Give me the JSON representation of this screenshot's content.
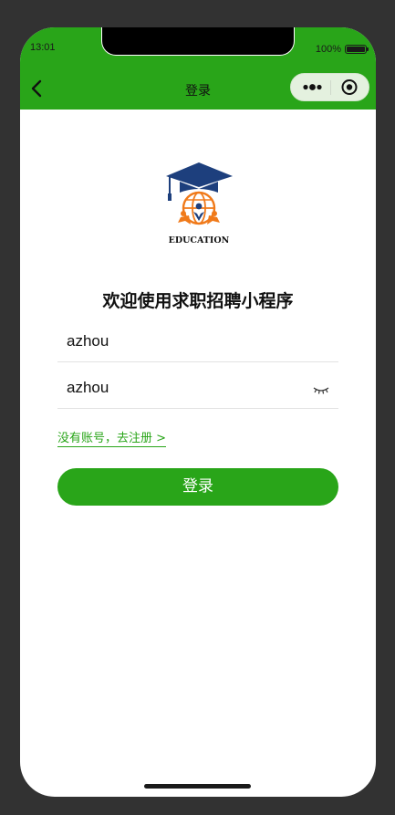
{
  "status_bar": {
    "time": "13:01",
    "battery": "100%"
  },
  "nav": {
    "title": "登录",
    "back_icon": "chevron-left-icon",
    "more_icon": "more-dots-icon",
    "close_icon": "target-close-icon"
  },
  "logo": {
    "icon": "graduation-cap-globe-icon",
    "text": "EDUCATION"
  },
  "main": {
    "title": "欢迎使用求职招聘小程序",
    "username": {
      "value": "azhou"
    },
    "password": {
      "value": "azhou",
      "toggle_icon": "eye-closed-icon"
    },
    "register_link": "没有账号，去注册 >",
    "login_button": "登录"
  },
  "colors": {
    "brand_green": "#29a519",
    "background": "#323232",
    "text": "#111111"
  }
}
